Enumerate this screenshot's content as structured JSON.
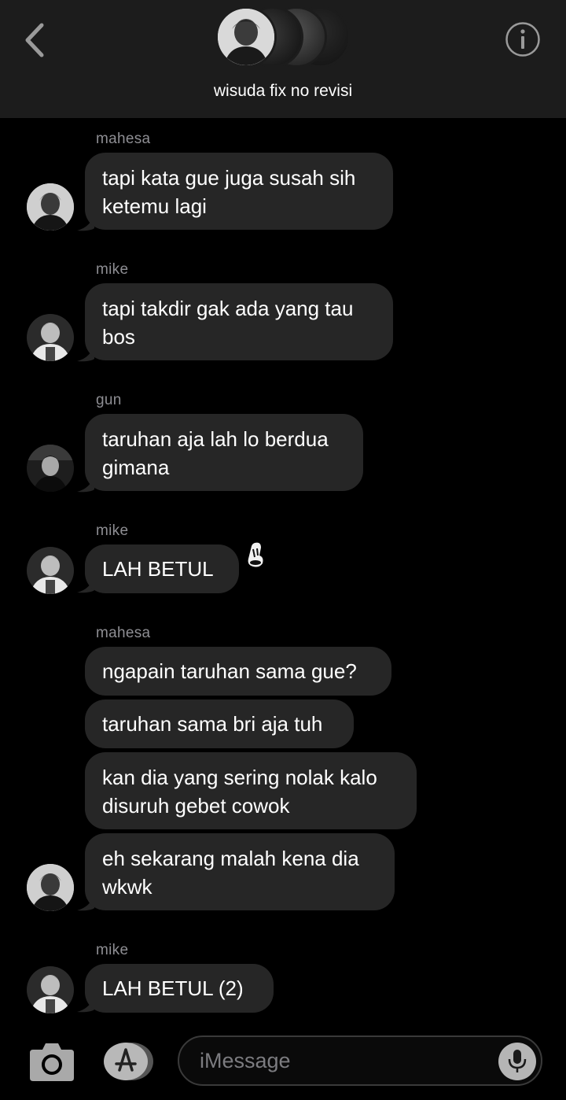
{
  "header": {
    "title": "wisuda fix no revisi",
    "back_icon": "chevron-left-icon",
    "info_icon": "info-icon",
    "group_avatar_count": 4
  },
  "messages": [
    {
      "sender": "mahesa",
      "bubbles": [
        "tapi kata gue juga susah sih\nketemu lagi"
      ]
    },
    {
      "sender": "mike",
      "bubbles": [
        "tapi takdir gak ada yang tau\nbos"
      ]
    },
    {
      "sender": "gun",
      "bubbles": [
        "taruhan aja lah lo berdua\ngimana"
      ]
    },
    {
      "sender": "mike",
      "bubbles": [
        "LAH BETUL"
      ],
      "reaction_icon": "emoji-sticker-icon"
    },
    {
      "sender": "mahesa",
      "bubbles": [
        "ngapain taruhan sama gue?",
        "taruhan sama bri aja tuh",
        "kan dia yang sering nolak kalo\ndisuruh gebet cowok",
        "eh sekarang malah kena dia\nwkwk"
      ]
    },
    {
      "sender": "mike",
      "bubbles": [
        "LAH BETUL (2)"
      ]
    }
  ],
  "composer": {
    "placeholder": "iMessage",
    "camera_icon": "camera-icon",
    "apps_icon": "app-store-icon",
    "mic_icon": "microphone-icon"
  },
  "colors": {
    "background": "#000000",
    "header_bg": "#1c1c1c",
    "bubble_bg": "#262626",
    "sender_text": "#8e8e93"
  }
}
